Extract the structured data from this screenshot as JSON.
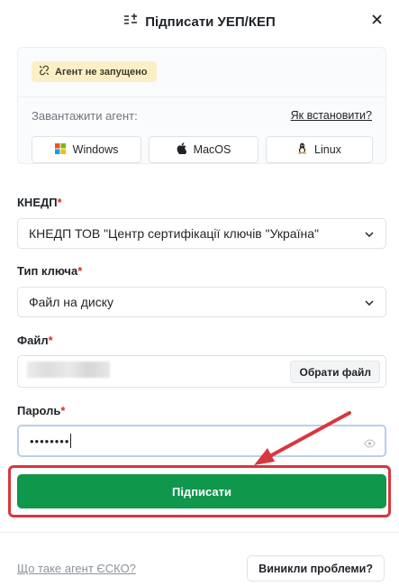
{
  "header": {
    "title": "Підписати УЕП/КЕП",
    "icon": "sign-icon",
    "close_icon": "close-icon"
  },
  "agent": {
    "status_badge": "Агент не запущено",
    "status_icon": "broken-link-icon",
    "download_label": "Завантажити агент:",
    "how_to_install": "Як встановити?",
    "os_buttons": [
      {
        "label": "Windows",
        "icon": "windows-icon"
      },
      {
        "label": "MacOS",
        "icon": "apple-icon"
      },
      {
        "label": "Linux",
        "icon": "linux-icon"
      }
    ]
  },
  "form": {
    "kned_label": "КНЕДП",
    "kned_value": "КНЕДП ТОВ \"Центр сертифікації ключів \"Україна\"",
    "key_type_label": "Тип ключа",
    "key_type_value": "Файл на диску",
    "file_label": "Файл",
    "file_button": "Обрати файл",
    "password_label": "Пароль",
    "password_value": "••••••••",
    "required_mark": "*"
  },
  "actions": {
    "submit": "Підписати",
    "what_is_agent": "Що таке агент ЄСКО?",
    "problems": "Виникли проблеми?"
  },
  "colors": {
    "primary_green": "#0f974c",
    "highlight_red": "#d9363e",
    "badge_yellow": "#fcefc6",
    "required_red": "#d0312d"
  }
}
